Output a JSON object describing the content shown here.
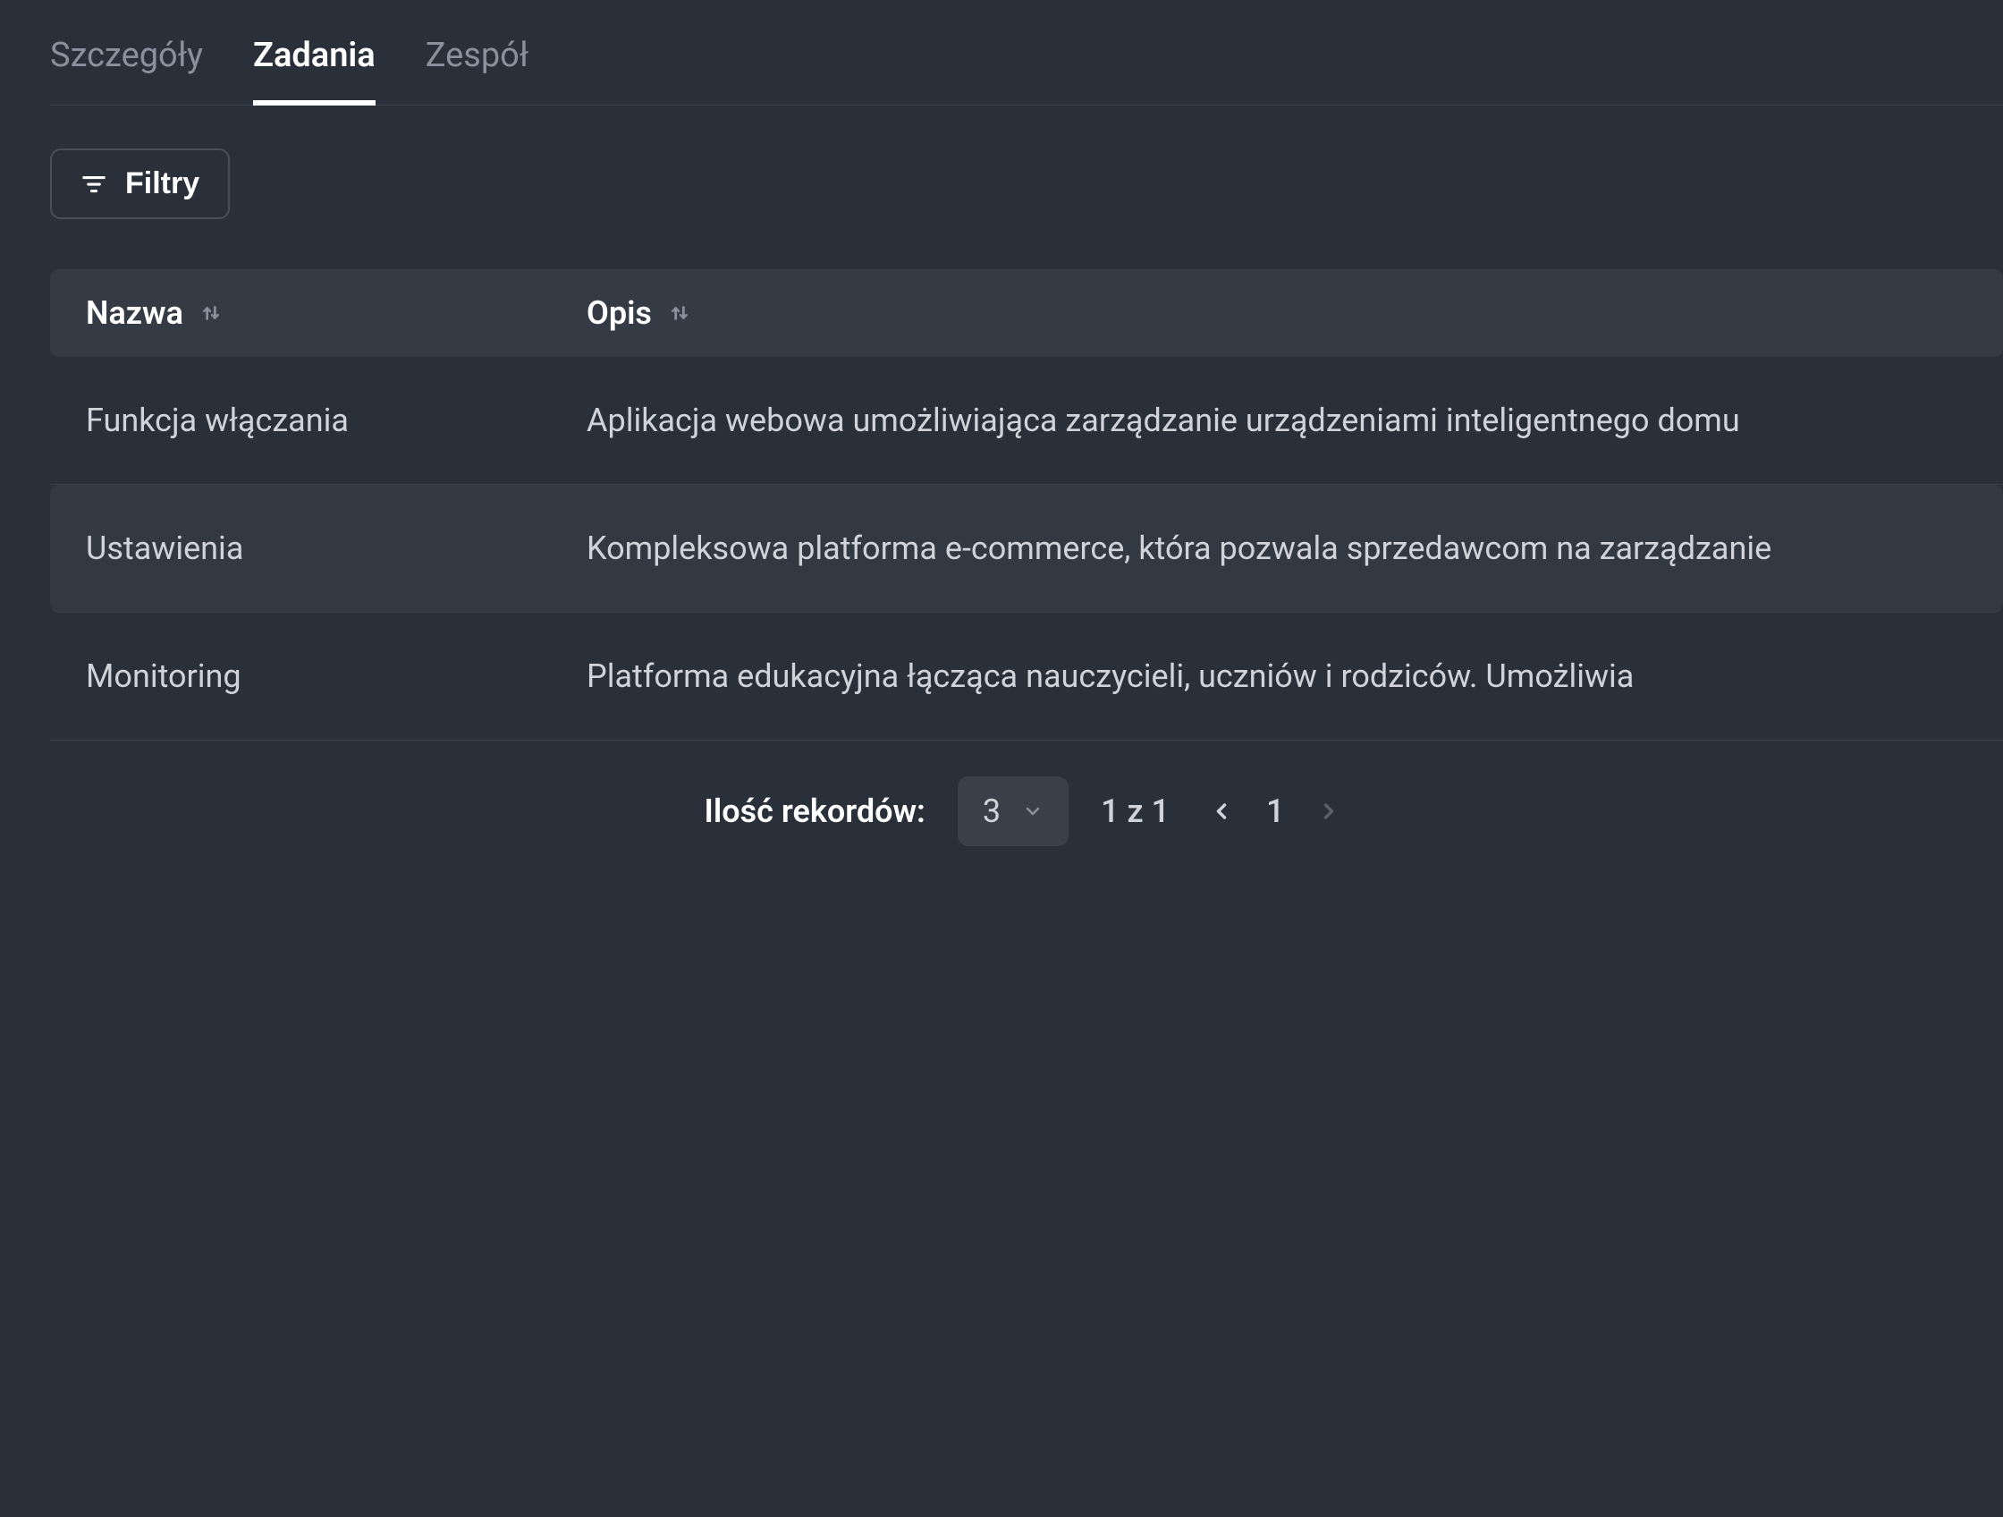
{
  "tabs": [
    {
      "label": "Szczegóły",
      "active": false
    },
    {
      "label": "Zadania",
      "active": true
    },
    {
      "label": "Zespół",
      "active": false
    }
  ],
  "filter": {
    "label": "Filtry"
  },
  "table": {
    "columns": [
      {
        "label": "Nazwa"
      },
      {
        "label": "Opis"
      }
    ],
    "rows": [
      {
        "name": "Funkcja włączania",
        "desc": "Aplikacja webowa umożliwiająca zarządzanie urządzeniami inteligentnego domu",
        "highlighted": false
      },
      {
        "name": "Ustawienia",
        "desc": "Kompleksowa platforma e-commerce, która pozwala sprzedawcom na zarządzanie",
        "highlighted": true
      },
      {
        "name": "Monitoring",
        "desc": "Platforma edukacyjna łącząca nauczycieli, uczniów i rodziców. Umożliwia",
        "highlighted": false
      }
    ]
  },
  "pagination": {
    "records_label": "Ilość rekordów:",
    "page_size": "3",
    "page_info": "1 z 1",
    "current_page": "1"
  }
}
